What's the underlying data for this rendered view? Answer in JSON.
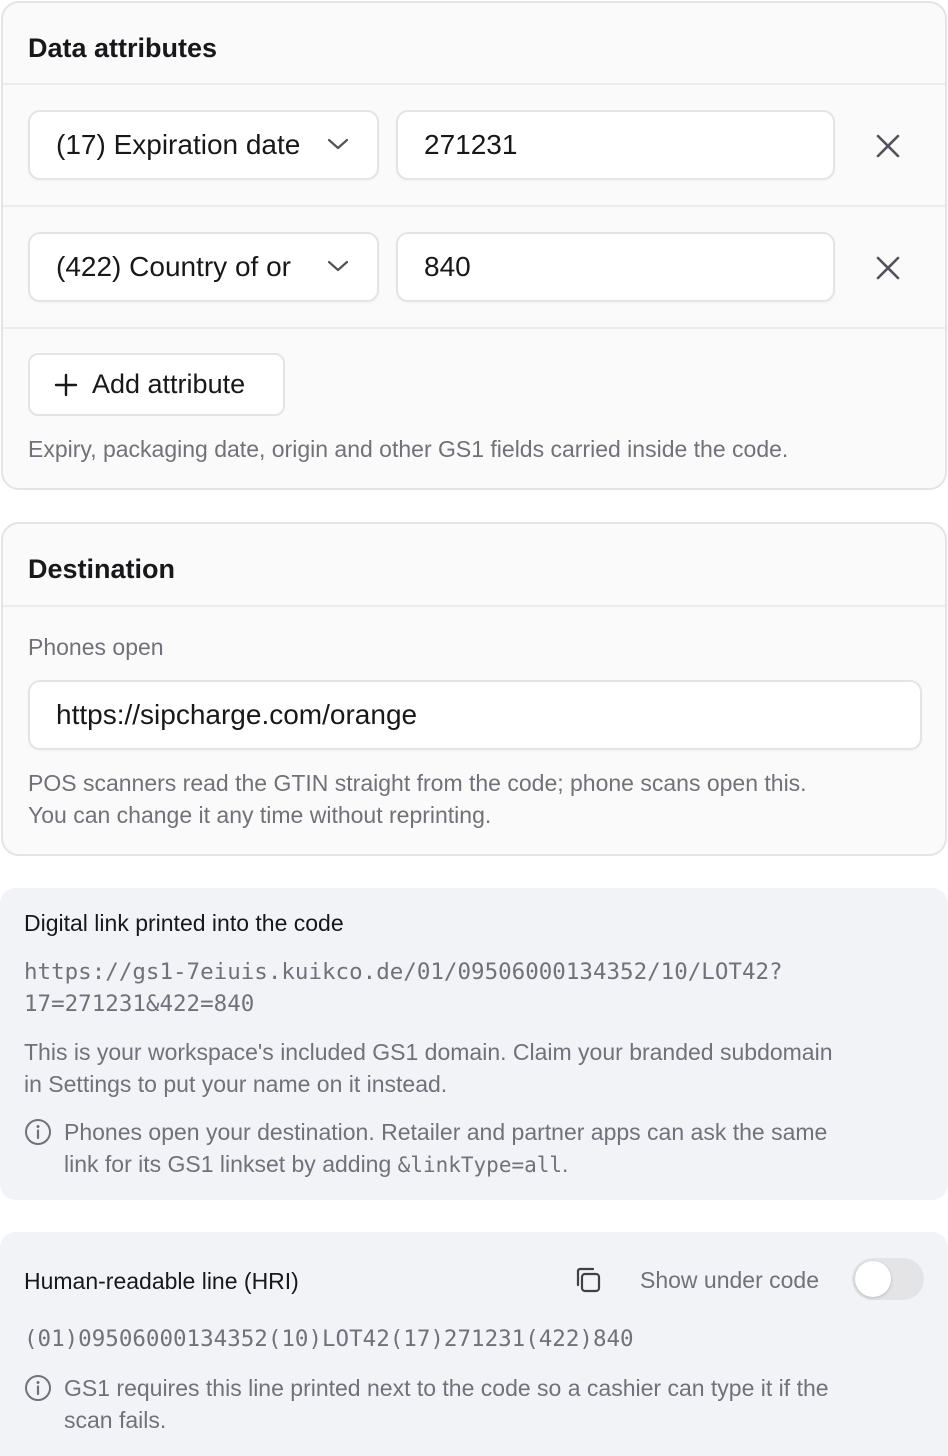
{
  "data_attributes": {
    "title": "Data attributes",
    "rows": [
      {
        "field": "(17) Expiration date",
        "value": "271231"
      },
      {
        "field": "(422) Country of or",
        "value": "840"
      }
    ],
    "add_button_label": "Add attribute",
    "help_text": "Expiry, packaging date, origin and other GS1 fields carried inside the code."
  },
  "destination": {
    "title": "Destination",
    "field_label": "Phones open",
    "url_value": "https://sipcharge.com/orange",
    "help_line1": "POS scanners read the GTIN straight from the code; phone scans open this.",
    "help_line2": "You can change it any time without reprinting."
  },
  "digital_link": {
    "title": "Digital link printed into the code",
    "link_line1": "https://gs1-7eiuis.kuikco.de/01/09506000134352/10/LOT42?",
    "link_line2": "17=271231&422=840",
    "description_line1": "This is your workspace's included GS1 domain. Claim your branded subdomain",
    "description_line2": "in Settings to put your name on it instead.",
    "info_line1": "Phones open your destination. Retailer and partner apps can ask the same",
    "info_line2_prefix": "link for its GS1 linkset by adding ",
    "info_code": "&linkType=all",
    "info_line2_suffix": "."
  },
  "hri": {
    "title": "Human-readable line (HRI)",
    "toggle_label": "Show under code",
    "toggle_on": false,
    "value": "(01)09506000134352(10)LOT42(17)271231(422)840",
    "info_line1": "GS1 requires this line printed next to the code so a cashier can type it if the",
    "info_line2": "scan fails."
  }
}
